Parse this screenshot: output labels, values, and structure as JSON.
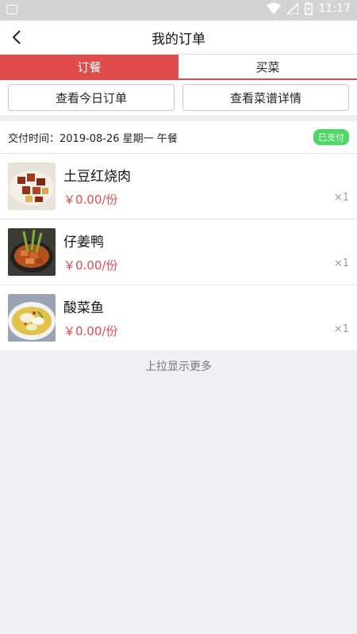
{
  "status": {
    "time": "11:17"
  },
  "header": {
    "title": "我的订单"
  },
  "tabs": [
    {
      "label": "订餐"
    },
    {
      "label": "买菜"
    }
  ],
  "actions": {
    "today_orders": "查看今日订单",
    "menu_details": "查看菜谱详情"
  },
  "order": {
    "delivery_label": "交付时间：2019-08-26  星期一  午餐",
    "status_badge": "已支付",
    "items": [
      {
        "name": "土豆红烧肉",
        "price": "￥0.00/份",
        "qty": "×1",
        "image": "braised-pork-with-potato-photo"
      },
      {
        "name": "仔姜鸭",
        "price": "￥0.00/份",
        "qty": "×1",
        "image": "ginger-duck-photo"
      },
      {
        "name": "酸菜鱼",
        "price": "￥0.00/份",
        "qty": "×1",
        "image": "pickled-cabbage-fish-photo"
      }
    ]
  },
  "footer": {
    "load_more": "上拉显示更多"
  },
  "colors": {
    "accent": "#e14b4b",
    "paid_badge": "#4cd964",
    "background": "#efeff4"
  }
}
